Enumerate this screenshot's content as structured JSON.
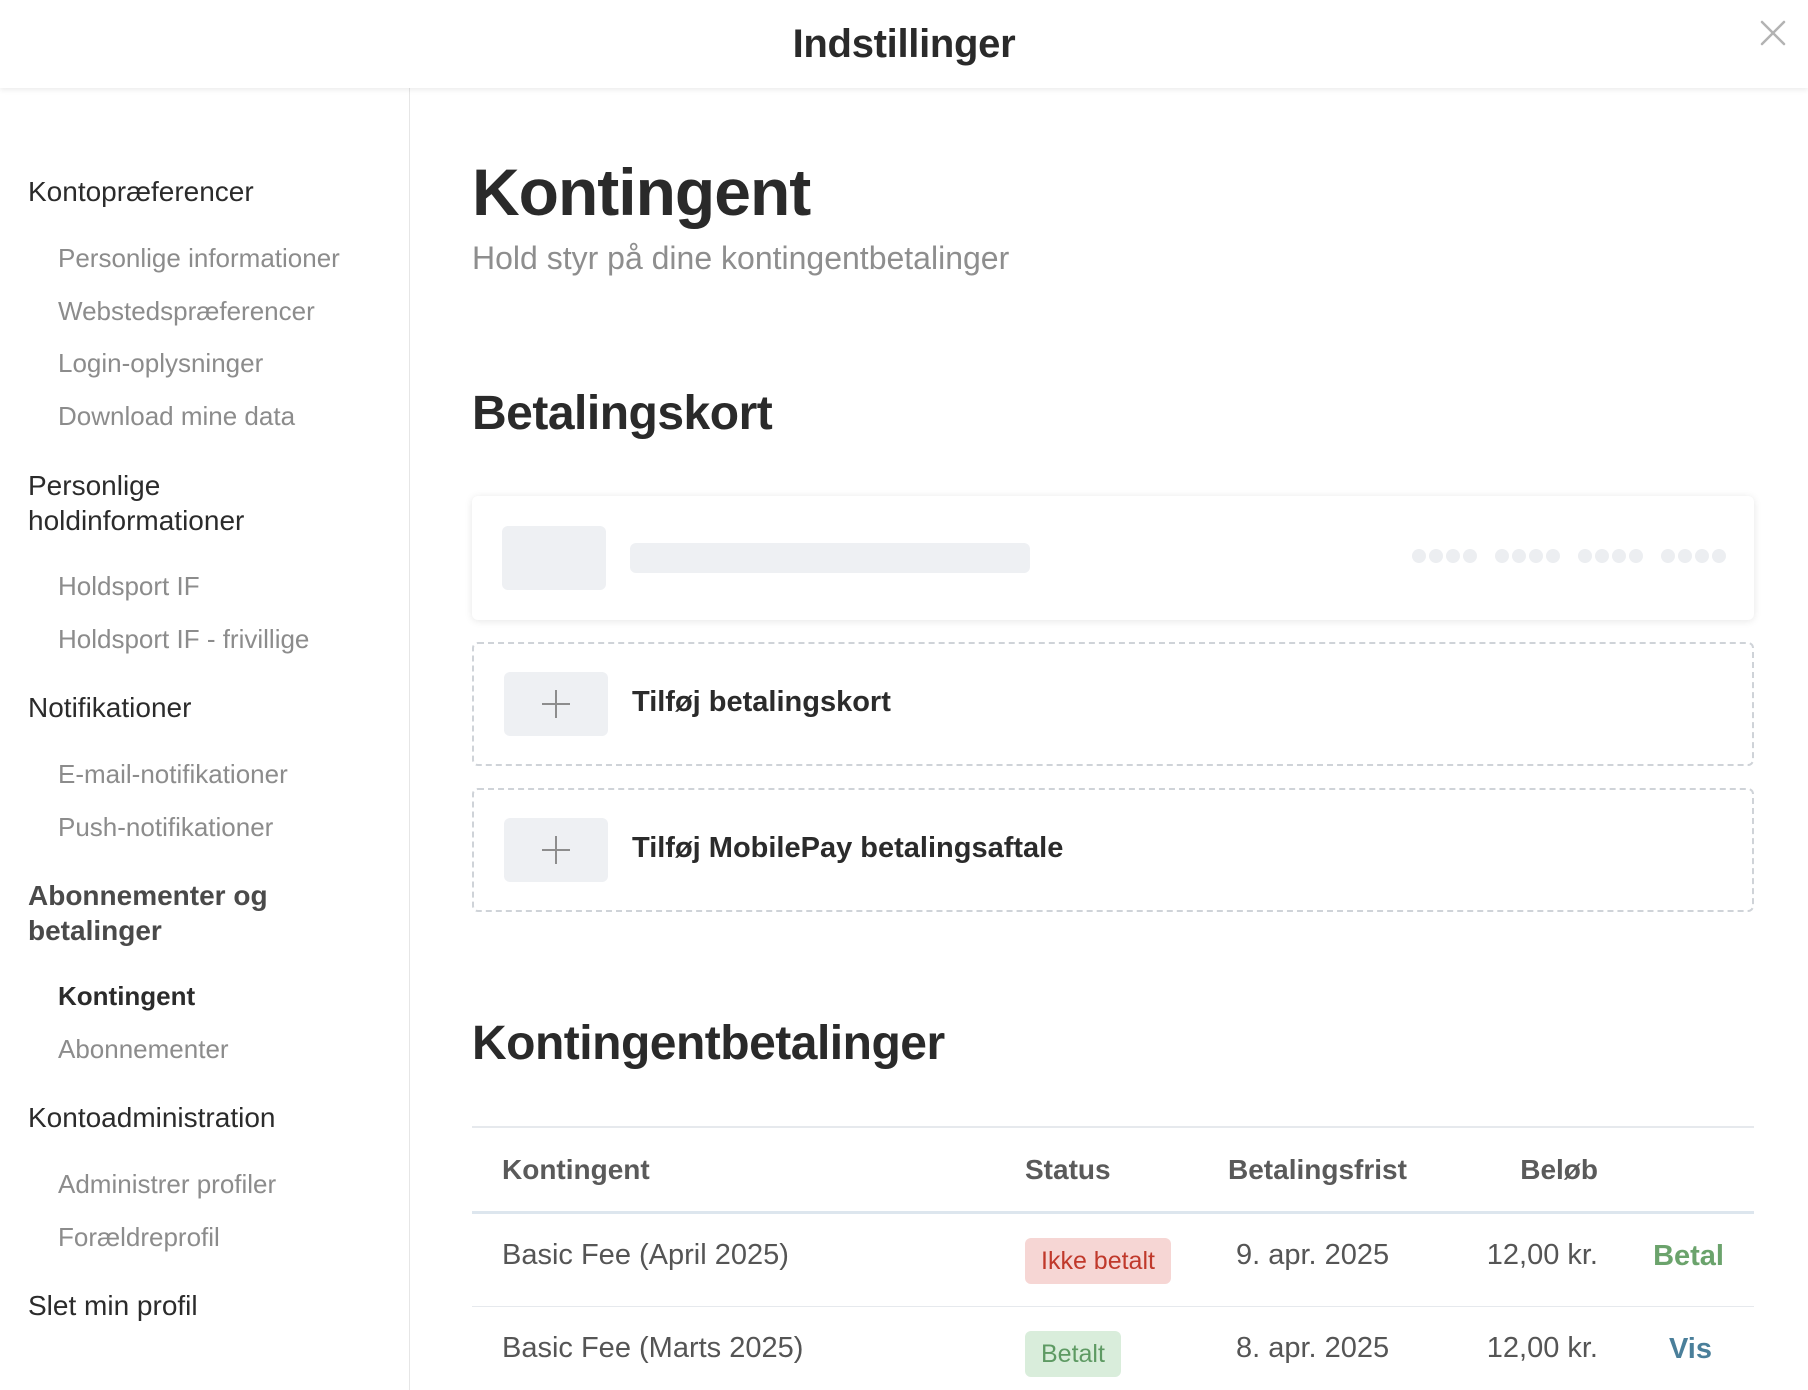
{
  "header": {
    "title": "Indstillinger"
  },
  "sidebar": {
    "groups": [
      {
        "label": "Kontopræferencer",
        "items": [
          "Personlige informationer",
          "Webstedspræferencer",
          "Login-oplysninger",
          "Download mine data"
        ]
      },
      {
        "label": "Personlige holdinformationer",
        "items": [
          "Holdsport IF",
          "Holdsport IF - frivillige"
        ]
      },
      {
        "label": "Notifikationer",
        "items": [
          "E-mail-notifikationer",
          "Push-notifikationer"
        ]
      },
      {
        "label": "Abonnementer og betalinger",
        "items": [
          "Kontingent",
          "Abonnementer"
        ]
      },
      {
        "label": "Kontoadministration",
        "items": [
          "Administrer profiler",
          "Forældreprofil"
        ]
      },
      {
        "label": "Slet min profil",
        "items": []
      }
    ],
    "active_item": "Kontingent"
  },
  "main": {
    "title": "Kontingent",
    "subtitle": "Hold styr på dine kontingentbetalinger",
    "payment_cards_title": "Betalingskort",
    "add_card_label": "Tilføj betalingskort",
    "add_mobilepay_label": "Tilføj MobilePay betalingsaftale",
    "payments_title": "Kontingentbetalinger",
    "table": {
      "headers": [
        "Kontingent",
        "Status",
        "Betalingsfrist",
        "Beløb"
      ],
      "rows": [
        {
          "name": "Basic Fee (April 2025)",
          "status": "Ikke betalt",
          "due": "9. apr. 2025",
          "amount": "12,00 kr.",
          "action": "Betal"
        },
        {
          "name": "Basic Fee (Marts 2025)",
          "status": "Betalt",
          "due": "8. apr. 2025",
          "amount": "12,00 kr.",
          "action": "Vis"
        }
      ]
    }
  },
  "icons": {
    "close": "close-icon",
    "add": "plus-icon"
  },
  "colors": {
    "unpaid": "#c0392b",
    "paid": "#5e9a63",
    "pay_action": "#6ba36c",
    "view_action": "#4a7f9a"
  }
}
